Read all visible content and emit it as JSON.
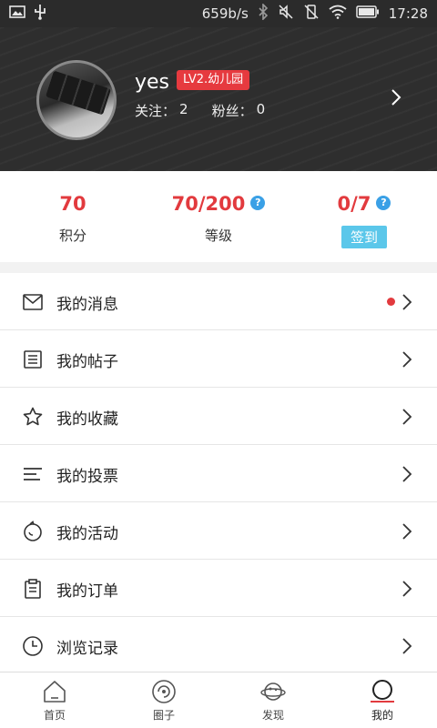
{
  "status_bar": {
    "speed": "659b/s",
    "time": "17:28",
    "icons": [
      "image-icon",
      "usb-icon",
      "bluetooth-icon",
      "mute-icon",
      "vibrate-icon",
      "wifi-icon",
      "battery-icon"
    ]
  },
  "profile": {
    "username": "yes",
    "level_badge": "LV2.幼儿园",
    "follow_label": "关注：",
    "follow_count": "2",
    "fans_label": "粉丝：",
    "fans_count": "0"
  },
  "stats": [
    {
      "value": "70",
      "label": "积分"
    },
    {
      "value": "70/200",
      "label": "等级"
    },
    {
      "value": "0/7",
      "button": "签到"
    }
  ],
  "menu": [
    {
      "label": "我的消息",
      "icon": "mail-icon",
      "dot": true
    },
    {
      "label": "我的帖子",
      "icon": "document-list-icon"
    },
    {
      "label": "我的收藏",
      "icon": "star-icon"
    },
    {
      "label": "我的投票",
      "icon": "vote-lines-icon"
    },
    {
      "label": "我的活动",
      "icon": "activity-icon"
    },
    {
      "label": "我的订单",
      "icon": "clipboard-icon"
    },
    {
      "label": "浏览记录",
      "icon": "clock-icon"
    }
  ],
  "bottom_nav": [
    {
      "label": "首页",
      "icon": "home-icon"
    },
    {
      "label": "圈子",
      "icon": "circle-icon"
    },
    {
      "label": "发现",
      "icon": "planet-icon"
    },
    {
      "label": "我的",
      "icon": "profile-icon",
      "active": true
    }
  ],
  "colors": {
    "accent": "#e23a3e",
    "info": "#3aa0e6",
    "signin": "#5bc7ea",
    "header_bg": "#2e2e2e"
  }
}
